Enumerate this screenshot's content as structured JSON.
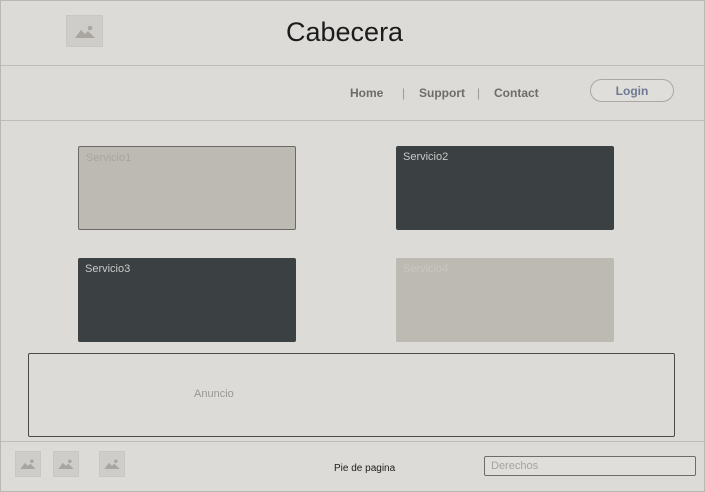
{
  "header": {
    "title": "Cabecera"
  },
  "nav": {
    "items": [
      "Home",
      "Support",
      "Contact"
    ],
    "separator": "|",
    "login_label": "Login"
  },
  "services": [
    {
      "label": "Servicio1"
    },
    {
      "label": "Servicio2"
    },
    {
      "label": "Servicio3"
    },
    {
      "label": "Servicio4"
    }
  ],
  "ad": {
    "label": "Anuncio"
  },
  "footer": {
    "text": "Pie de pagina",
    "rights_placeholder": "Derechos"
  },
  "icons": {
    "header_logo": "image-placeholder-icon",
    "footer_images": [
      "image-placeholder-icon",
      "image-placeholder-icon",
      "image-placeholder-icon"
    ]
  },
  "colors": {
    "background": "#dcdbd7",
    "service_dark": "#3b4043",
    "service_light": "#bdbab4",
    "login_text": "#6d7a92"
  }
}
